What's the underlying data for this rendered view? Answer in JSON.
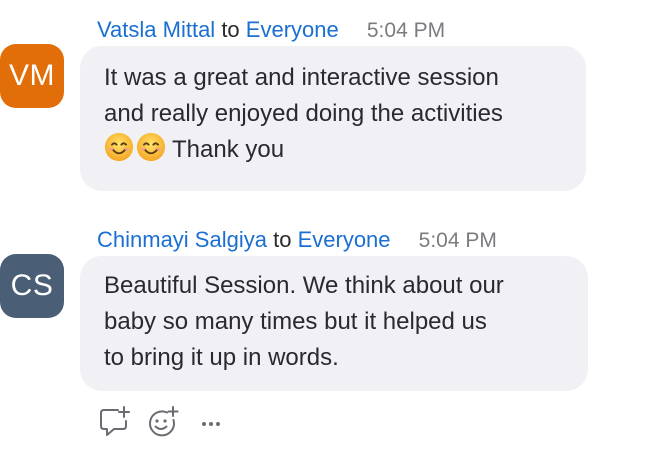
{
  "messages": [
    {
      "avatar_initials": "VM",
      "sender": "Vatsla Mittal",
      "to_word": "to",
      "recipient": "Everyone",
      "time": "5:04 PM",
      "lines": [
        "It was a great and interactive session",
        "and really enjoyed doing the activities"
      ],
      "emoji_line_text": "Thank you",
      "emojis": [
        "smiling-face-emoji",
        "smiling-face-emoji"
      ],
      "avatar_color": "#e16e09"
    },
    {
      "avatar_initials": "CS",
      "sender": "Chinmayi Salgiya",
      "to_word": "to",
      "recipient": "Everyone",
      "time": "5:04 PM",
      "lines": [
        "Beautiful Session. We think about our",
        "baby so many times but it helped us",
        "to bring it up in words."
      ],
      "avatar_color": "#4a5f75"
    }
  ],
  "actions": {
    "icons": [
      "reply-in-thread-icon",
      "add-reaction-icon",
      "more-options-icon"
    ]
  },
  "colors": {
    "link_blue": "#1a6fd1",
    "bubble_bg": "#f0f0f5",
    "text": "#2a2a2e",
    "timestamp": "#7c7c80"
  }
}
